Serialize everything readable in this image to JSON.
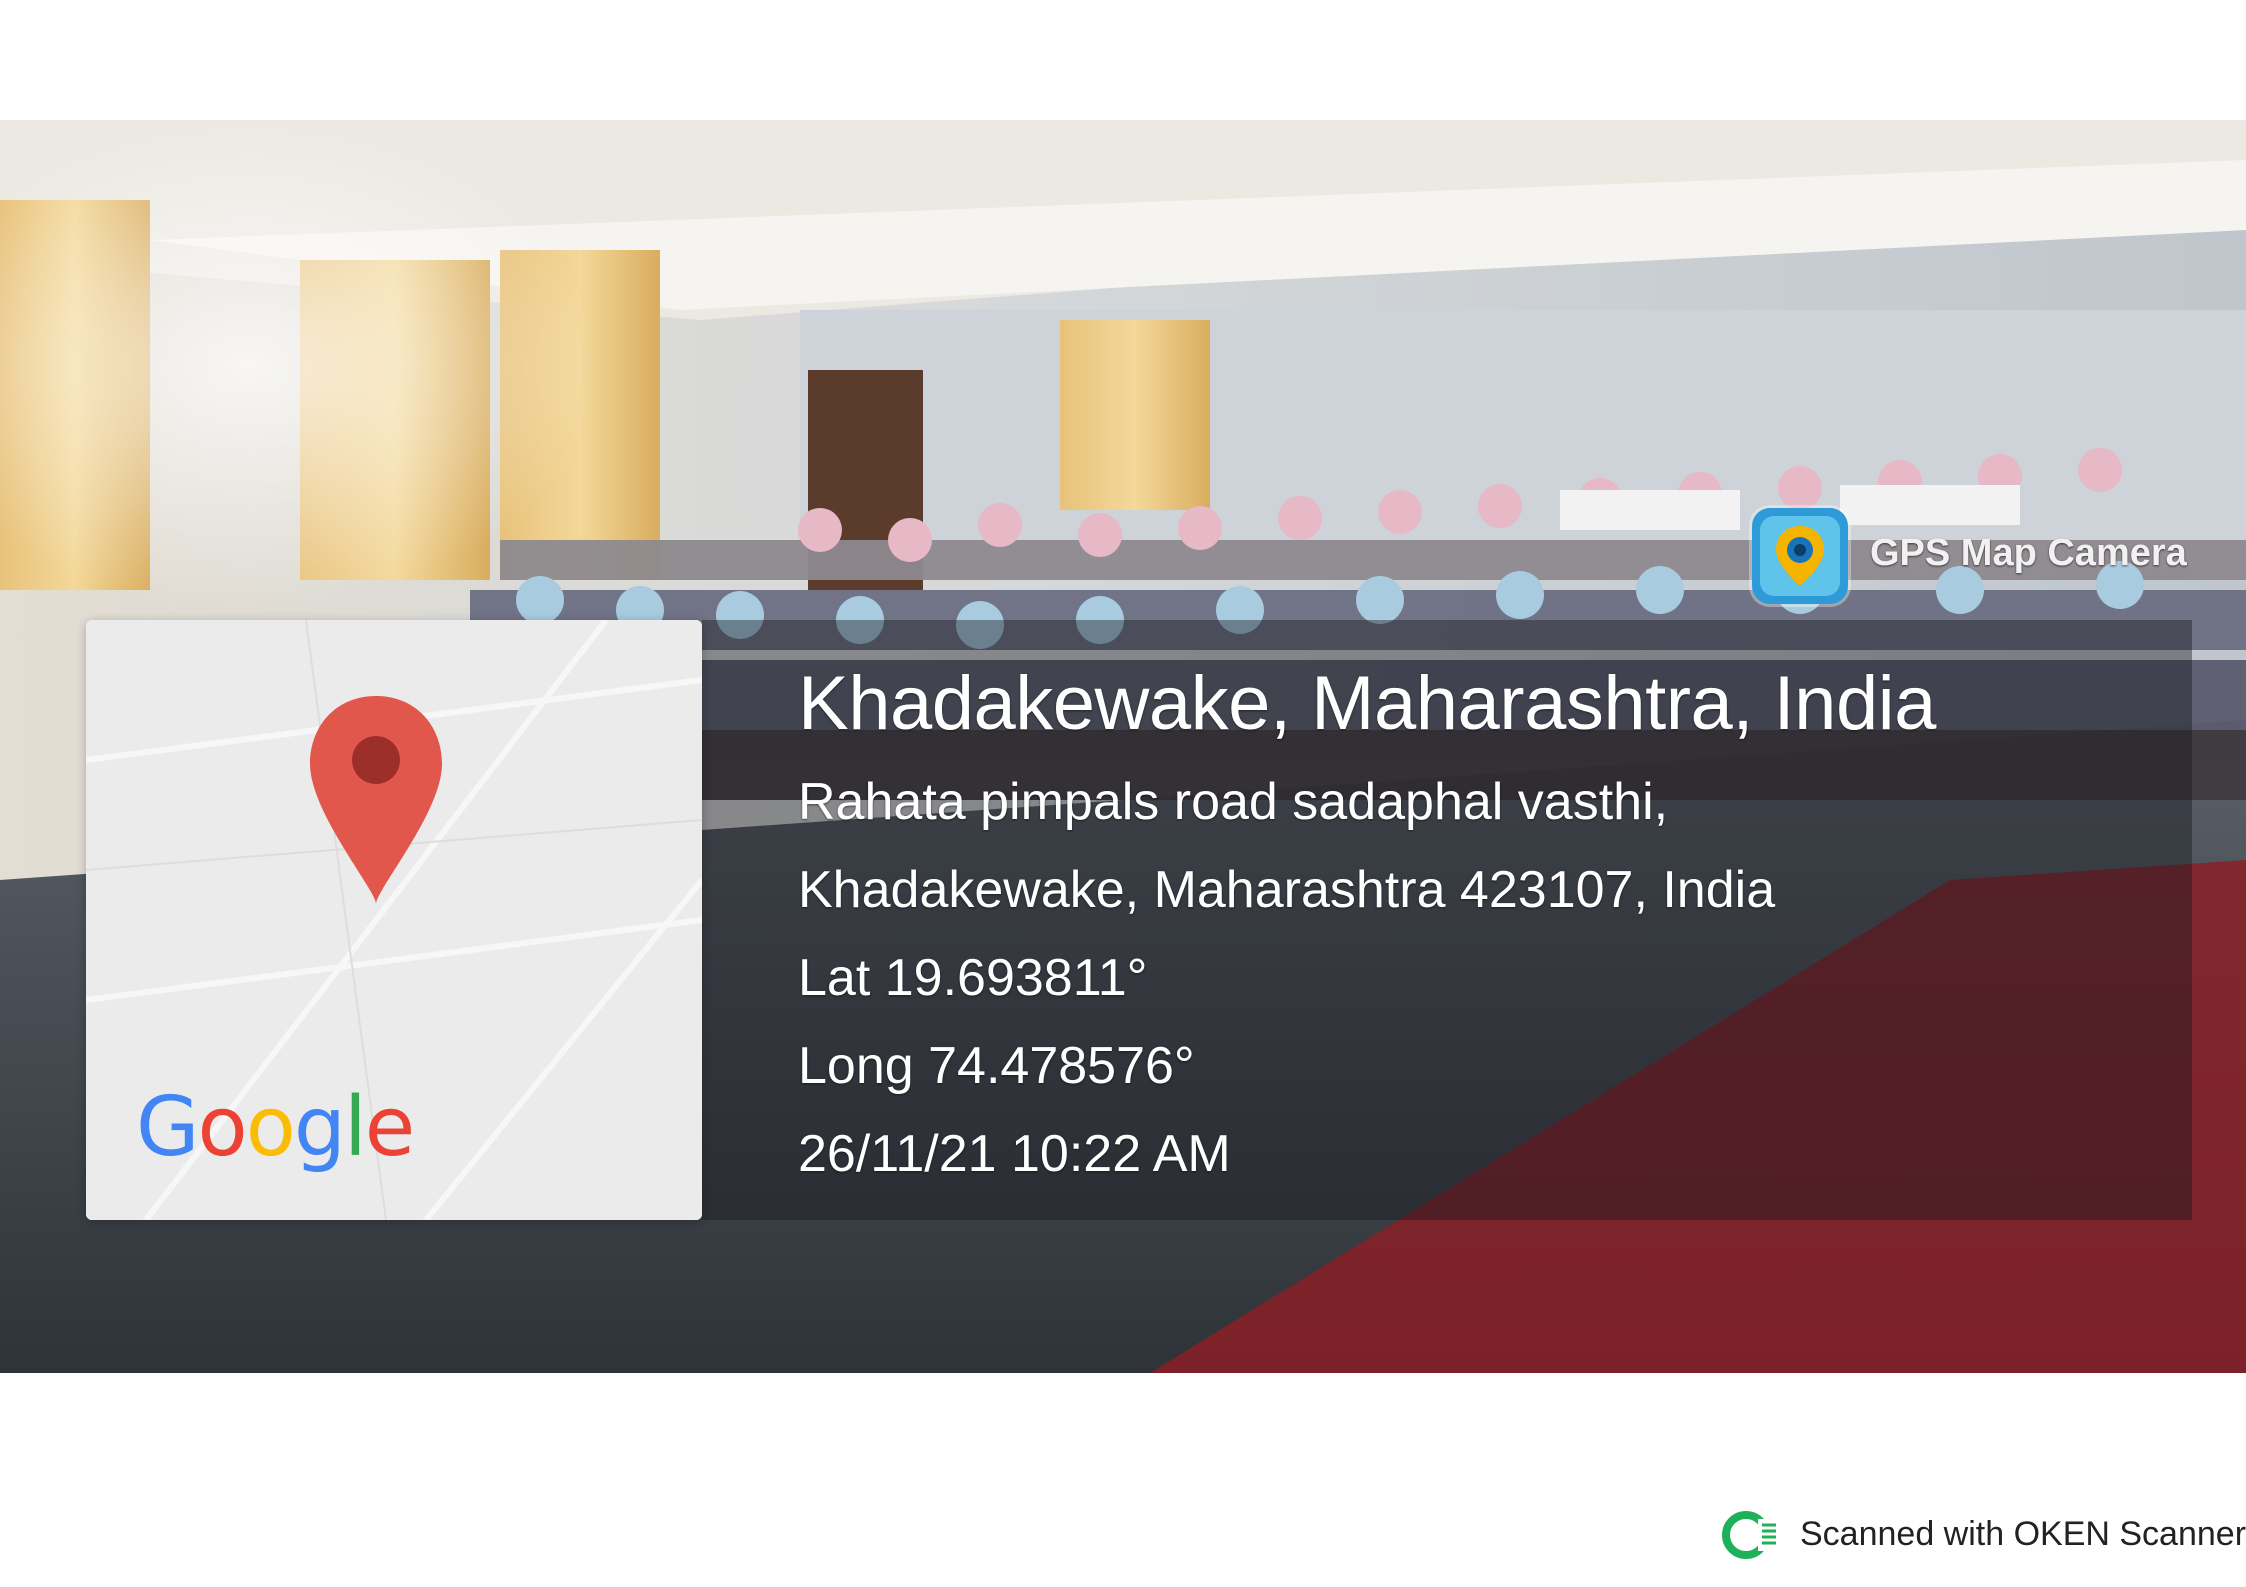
{
  "photo": {
    "location_title": "Khadakewake, Maharashtra, India",
    "address_line1": "Rahata pimpals road sadaphal vasthi,",
    "address_line2": "Khadakewake, Maharashtra 423107, India",
    "latitude": "Lat 19.693811°",
    "longitude": "Long 74.478576°",
    "datetime": "26/11/21 10:22 AM"
  },
  "map": {
    "logo_text": "Google",
    "logo_letters": [
      {
        "char": "G",
        "color": "#4285F4"
      },
      {
        "char": "o",
        "color": "#EA4335"
      },
      {
        "char": "o",
        "color": "#FBBC05"
      },
      {
        "char": "g",
        "color": "#4285F4"
      },
      {
        "char": "l",
        "color": "#34A853"
      },
      {
        "char": "e",
        "color": "#EA4335"
      }
    ],
    "pin_icon": "map-pin-icon",
    "pin_color": "#E2574C"
  },
  "badge": {
    "label": "GPS Map Camera",
    "icon": "gps-map-camera-icon"
  },
  "footer": {
    "scanner_text": "Scanned with OKEN Scanner",
    "scanner_icon": "oken-scanner-icon",
    "scanner_color": "#1fb15a"
  }
}
